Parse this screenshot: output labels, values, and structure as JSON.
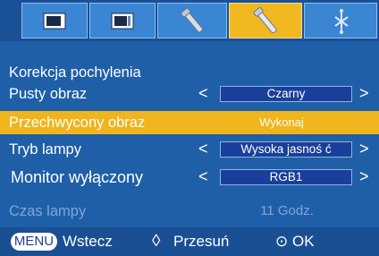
{
  "tabs": [
    {
      "name": "picture-tab",
      "icon": "screen-icon"
    },
    {
      "name": "screen-tab",
      "icon": "monitor-icon"
    },
    {
      "name": "tools-tab",
      "icon": "wrench-icon"
    },
    {
      "name": "settings-tab",
      "icon": "wrench-screwdriver-icon",
      "active": true
    },
    {
      "name": "network-tab",
      "icon": "network-icon"
    }
  ],
  "menu": {
    "keystone_label": "Korekcja pochylenia",
    "blank_label": "Pusty obraz",
    "blank_value": "Czarny",
    "capture_label": "Przechwycony obraz",
    "capture_value": "Wykonaj",
    "lamp_mode_label": "Tryb lampy",
    "lamp_mode_value": "Wysoka jasnoś ć",
    "monitor_off_label": "Monitor wyłączony",
    "monitor_off_value": "RGB1",
    "lamp_time_label": "Czas lampy",
    "lamp_time_value": "11 Godz."
  },
  "arrows": {
    "left": "<",
    "right": ">"
  },
  "footer": {
    "menu_key": "MENU",
    "back_label": "Wstecz",
    "move_symbol": "◊",
    "move_label": "Przesuń",
    "ok_symbol": "⊙",
    "ok_label": "OK"
  },
  "colors": {
    "background": "#1f5fa8",
    "tab": "#3a86d2",
    "active_tab": "#f2b822",
    "highlight": "#f0b41c",
    "value_box": "#1a3f9a"
  }
}
